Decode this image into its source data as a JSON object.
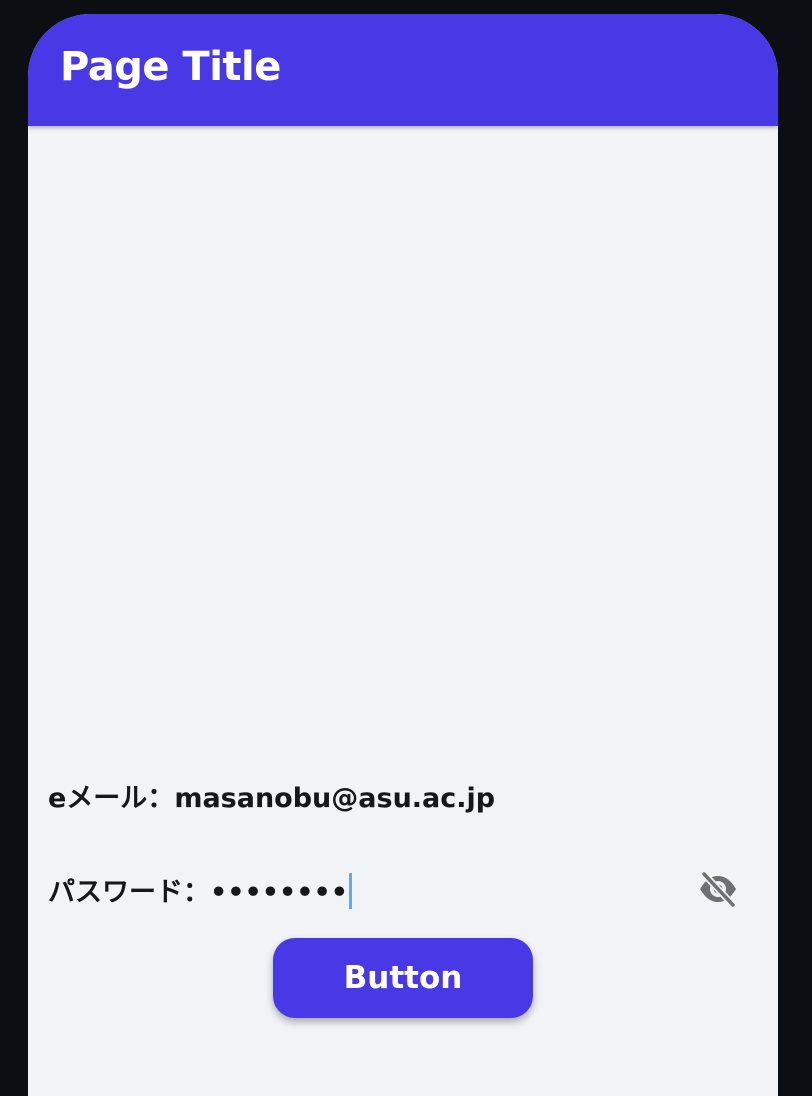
{
  "app_bar": {
    "title": "Page Title",
    "color": "#4838e6"
  },
  "form": {
    "email": {
      "label": "eメール：",
      "value": "masanobu@asu.ac.jp"
    },
    "password": {
      "label": "パスワード：",
      "value": "••••••••",
      "visibility_icon": "eye-off-icon"
    }
  },
  "button": {
    "label": "Button",
    "color": "#4838e6"
  }
}
